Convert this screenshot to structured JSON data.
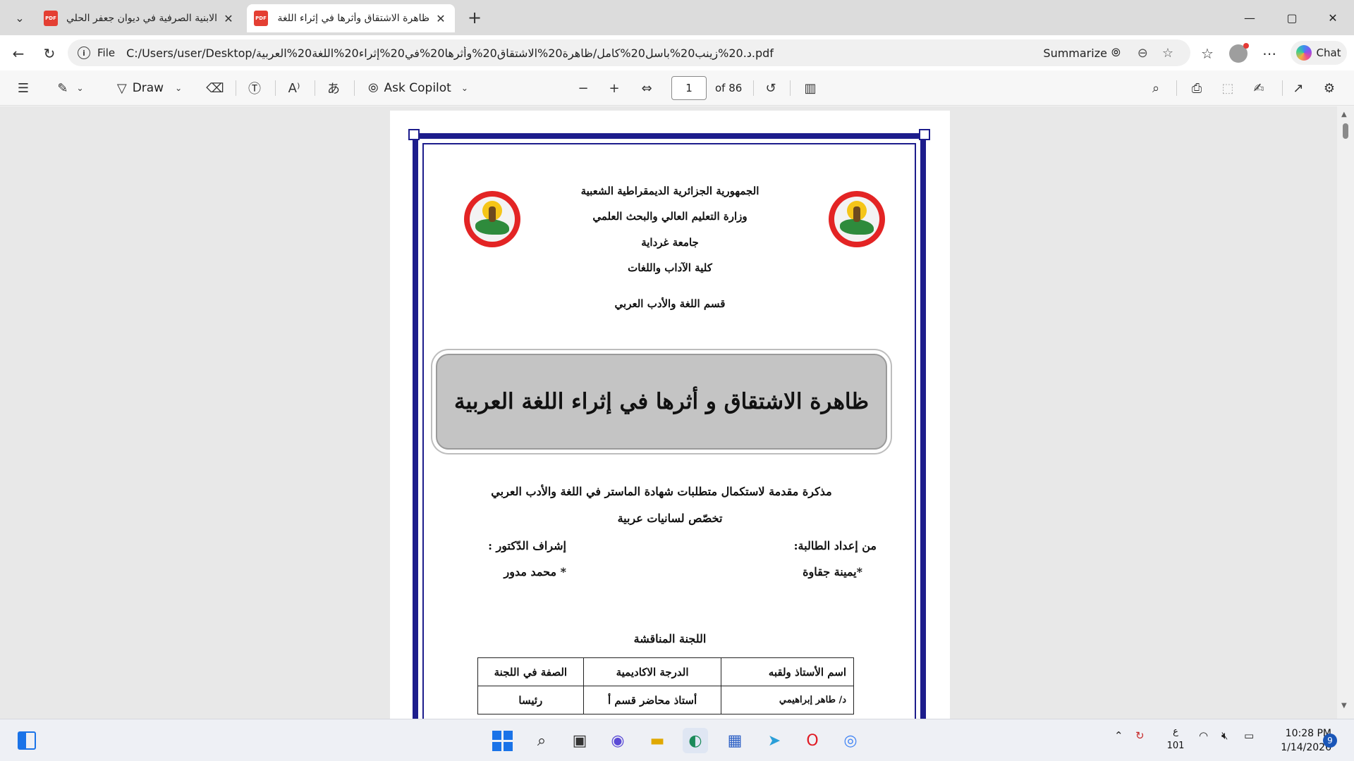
{
  "browser": {
    "tabs": [
      {
        "title": "الابنية الصرفية في ديوان جعفر الحلي",
        "active": false
      },
      {
        "title": "ظاهرة الاشتقاق وأثرها في إثراء اللغة",
        "active": true
      }
    ],
    "address": {
      "scheme_label": "File",
      "url": "C:/Users/user/Desktop/د.20%زينب20%باسل20%كامل/ظاهرة20%الاشتقاق20%وأثرها20%في20%إثراء20%اللغة20%العربية.pdf",
      "summarize_label": "Summarize",
      "chat_label": "Chat"
    }
  },
  "pdf_toolbar": {
    "draw_label": "Draw",
    "ask_copilot_label": "Ask Copilot",
    "current_page": "1",
    "page_count_label": "of 86"
  },
  "document": {
    "header_lines": [
      "الجمهورية الجزائرية الديمقراطية الشعبية",
      "وزارة التعليم العالي والبحث العلمي",
      "جامعة غرداية",
      "كلية الآداب واللغات",
      "قسم اللغة والأدب العربي"
    ],
    "title": "ظاهرة الاشتقاق و أثرها في إثراء اللغة العربية",
    "subtitle_1": "مذكرة مقدمة لاستكمال متطلبات شهادة الماستر في اللغة والأدب العربي",
    "subtitle_2": "تخصّص لسانيات عربية",
    "prepared_by_label": "من إعداد الطالبة:",
    "student_name": "*يمينة جقاوة",
    "supervisor_label": "إشراف الدّكتور :",
    "supervisor_name": "*  محمد مدور",
    "committee_title": "اللجنة المناقشة",
    "committee_headers": [
      "اسم الأستاذ ولقبه",
      "الدرجة الاكاديمية",
      "الصفة في اللجنة"
    ],
    "committee_rows": [
      [
        "د/ طاهر إبراهيمي",
        "أستاذ محاضر قسم أ",
        "رئيسا"
      ]
    ]
  },
  "taskbar": {
    "lang_top": "ع",
    "lang_bottom": "101",
    "time": "10:28 PM",
    "date": "1/14/2026",
    "notification_count": "9"
  },
  "colors": {
    "border_blue": "#1d1d8c",
    "title_box": "#c4c4c4",
    "seal_red": "#e32424"
  }
}
